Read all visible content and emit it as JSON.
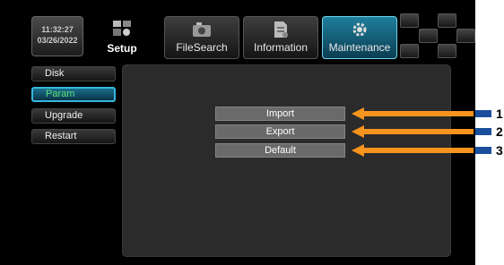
{
  "clock": {
    "time": "11:32:27",
    "date": "03/26/2022"
  },
  "tabs": [
    {
      "label": "Setup",
      "icon": "setup-icon",
      "active": false
    },
    {
      "label": "FileSearch",
      "icon": "camera-icon",
      "active": false
    },
    {
      "label": "Information",
      "icon": "document-icon",
      "active": false
    },
    {
      "label": "Maintenance",
      "icon": "gear-icon",
      "active": true
    }
  ],
  "sidebar": {
    "items": [
      {
        "label": "Disk"
      },
      {
        "label": "Param",
        "selected": true
      },
      {
        "label": "Upgrade"
      },
      {
        "label": "Restart"
      }
    ]
  },
  "main": {
    "buttons": [
      {
        "label": "Import"
      },
      {
        "label": "Export"
      },
      {
        "label": "Default"
      }
    ]
  },
  "callouts": [
    "1",
    "2",
    "3"
  ],
  "colors": {
    "arrow": "#f7941d",
    "marker": "#1b4f9c",
    "active_tab": "#1f7f9c",
    "selected_text": "#5fe07a"
  }
}
